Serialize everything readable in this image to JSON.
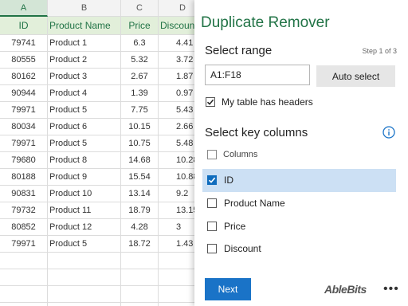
{
  "sheet": {
    "col_letters": [
      "A",
      "B",
      "C",
      "D"
    ],
    "headers": [
      "ID",
      "Product Name",
      "Price",
      "Discoun"
    ],
    "rows": [
      [
        "79741",
        "Product 1",
        "6.3",
        "4.41"
      ],
      [
        "80555",
        "Product 2",
        "5.32",
        "3.72"
      ],
      [
        "80162",
        "Product 3",
        "2.67",
        "1.87"
      ],
      [
        "90944",
        "Product 4",
        "1.39",
        "0.97"
      ],
      [
        "79971",
        "Product 5",
        "7.75",
        "5.43"
      ],
      [
        "80034",
        "Product 6",
        "10.15",
        "2.66"
      ],
      [
        "79971",
        "Product 5",
        "10.75",
        "5.48"
      ],
      [
        "79680",
        "Product 8",
        "14.68",
        "10.28"
      ],
      [
        "80188",
        "Product 9",
        "15.54",
        "10.88"
      ],
      [
        "90831",
        "Product 10",
        "13.14",
        "9.2"
      ],
      [
        "79732",
        "Product 11",
        "18.79",
        "13.15"
      ],
      [
        "80852",
        "Product 12",
        "4.28",
        "3"
      ],
      [
        "79971",
        "Product 5",
        "18.72",
        "1.43"
      ],
      [
        "",
        "",
        "",
        ""
      ],
      [
        "",
        "",
        "",
        ""
      ],
      [
        "",
        "",
        "",
        ""
      ],
      [
        "",
        "",
        "",
        ""
      ]
    ]
  },
  "pane": {
    "title": "Duplicate Remover",
    "select_range_title": "Select range",
    "step_label": "Step 1 of 3",
    "range_value": "A1:F18",
    "auto_select_label": "Auto select",
    "has_headers_label": "My table has headers",
    "has_headers_checked": true,
    "key_columns_title": "Select key columns",
    "columns_header_label": "Columns",
    "columns": [
      {
        "label": "ID",
        "checked": true
      },
      {
        "label": "Product Name",
        "checked": false
      },
      {
        "label": "Price",
        "checked": false
      },
      {
        "label": "Discount",
        "checked": false
      }
    ],
    "next_label": "Next",
    "logo_text": "AbleBits",
    "more_label": "•••",
    "icons": {
      "info": "info-icon",
      "check": "checkmark-icon",
      "more": "more-icon"
    }
  },
  "colors": {
    "accent_green": "#217346",
    "header_fill": "#e2efda",
    "selection_blue": "#cce0f4",
    "primary_button": "#1a73c7"
  }
}
